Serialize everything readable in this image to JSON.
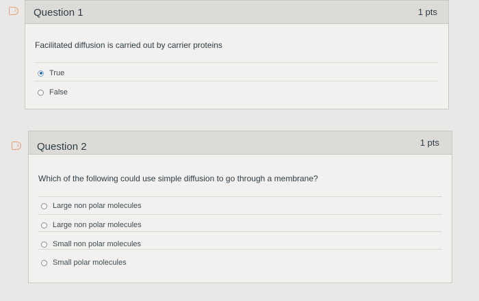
{
  "colors": {
    "background": "#e9e8e6",
    "card": "#f2f1ef",
    "header": "#dcdbd8",
    "flag": "#e3a17a",
    "selected": "#2b6cb0"
  },
  "questions": [
    {
      "title": "Question 1",
      "points": "1 pts",
      "text": "Facilitated diffusion is carried out by carrier proteins",
      "answers": [
        {
          "label": "True",
          "selected": true
        },
        {
          "label": "False",
          "selected": false
        }
      ]
    },
    {
      "title": "Question 2",
      "points": "1 pts",
      "text": "Which of the following could use simple diffusion to go through a membrane?",
      "answers": [
        {
          "label": "Large non polar molecules",
          "selected": false
        },
        {
          "label": "Large non polar molecules",
          "selected": false
        },
        {
          "label": "Small non polar molecules",
          "selected": false
        },
        {
          "label": "Small polar molecules",
          "selected": false
        }
      ]
    }
  ]
}
